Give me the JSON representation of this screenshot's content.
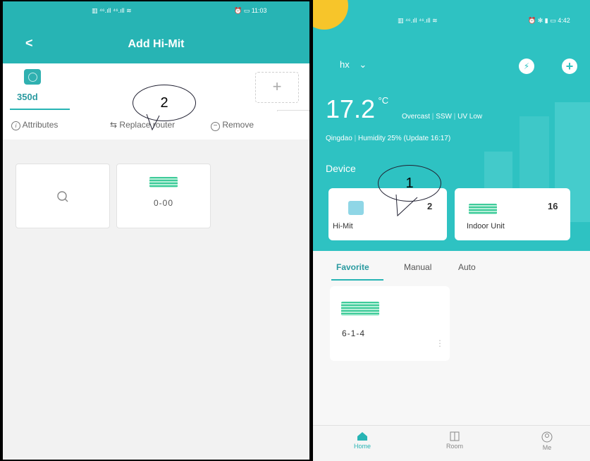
{
  "left": {
    "status_bar": {
      "left": "▥ ⁴⁶.ıll ⁴⁶.ıll ≋",
      "right": "⏰ ▭ 11:03"
    },
    "header": {
      "back_icon": "back-chevron",
      "title": "Add Hi-Mit"
    },
    "gateway_tab": {
      "label": "350d",
      "icon": "gateway-icon"
    },
    "add_button": {
      "icon": "plus-icon",
      "glyph": "+"
    },
    "dropdown_glyph": "﹀",
    "actions": {
      "attributes": {
        "icon": "info-icon",
        "label": "Attributes"
      },
      "replace_router": {
        "icon": "swap-icon",
        "label": "Replace router"
      },
      "remove": {
        "icon": "minus-circle-icon",
        "label": "Remove"
      }
    },
    "cards": [
      {
        "type": "search",
        "icon": "search-icon"
      },
      {
        "type": "device",
        "icon": "indoor-unit-icon",
        "label": "0-00"
      }
    ],
    "callout": "2"
  },
  "right": {
    "status_bar": {
      "left": "▥ ⁴⁶.ıll ⁴⁶.ıll ≋",
      "right": "⏰ ✻ ▮ ▭ 4:42"
    },
    "home_selector": {
      "label": "hx",
      "chevron": "⌄"
    },
    "weather": {
      "temperature": "17.2",
      "unit": "°C",
      "condition": "Overcast",
      "wind": "SSW",
      "uv": "UV Low",
      "city": "Qingdao",
      "humidity": "Humidity 25%",
      "update": "(Update 16:17)"
    },
    "device_section_title": "Device",
    "devices": [
      {
        "name": "Hi-Mit",
        "count": "2",
        "icon": "gateway-icon"
      },
      {
        "name": "Indoor Unit",
        "count": "16",
        "icon": "indoor-unit-icon"
      }
    ],
    "tabs": [
      {
        "label": "Favorite",
        "active": true
      },
      {
        "label": "Manual",
        "active": false
      },
      {
        "label": "Auto",
        "active": false
      }
    ],
    "favorite_card": {
      "label": "6-1-4",
      "icon": "indoor-unit-icon",
      "menu": "⋮"
    },
    "bottom_nav": [
      {
        "label": "Home",
        "icon": "home-icon",
        "active": true
      },
      {
        "label": "Room",
        "icon": "room-icon",
        "active": false
      },
      {
        "label": "Me",
        "icon": "user-icon",
        "active": false
      }
    ],
    "callout": "1"
  },
  "colors": {
    "teal": "#27b4b4",
    "accent_text": "#2a9aa0",
    "unit_green": "#3ecb9a",
    "sun": "#f7c52a"
  }
}
